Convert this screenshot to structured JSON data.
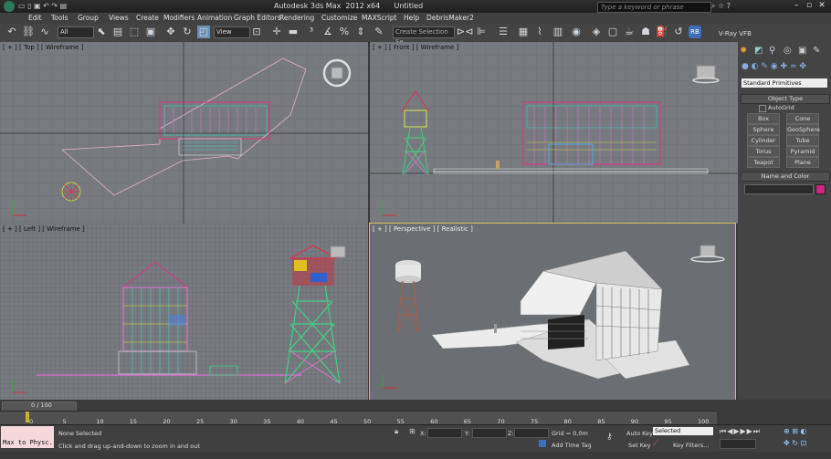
{
  "window": {
    "title": "Autodesk 3ds Max  2012 x64      Untitled",
    "search_placeholder": "Type a keyword or phrase"
  },
  "menu": [
    "Edit",
    "Tools",
    "Group",
    "Views",
    "Create",
    "Modifiers",
    "Animation",
    "Graph Editors",
    "Rendering",
    "Customize",
    "MAXScript",
    "Help",
    "DebrisMaker2"
  ],
  "toolbar": {
    "filter_value": "All",
    "view_value": "View",
    "selection_set_placeholder": "Create Selection Se",
    "vray_label": "V-Ray VFB"
  },
  "viewports": {
    "top_label": "[ + ] [ Top ] [ Wireframe ]",
    "front_label": "[ + ] [ Front ] [ Wireframe ]",
    "left_label": "[ + ] [ Left ] [ Wireframe ]",
    "perspective_label": "[ + ] [ Perspective ] [ Realistic ]"
  },
  "command_panel": {
    "category": "Standard Primitives",
    "object_type_title": "Object Type",
    "autogrid": "AutoGrid",
    "buttons": [
      "Box",
      "Cone",
      "Sphere",
      "GeoSphere",
      "Cylinder",
      "Tube",
      "Torus",
      "Pyramid",
      "Teapot",
      "Plane"
    ],
    "name_color_title": "Name and Color",
    "object_color": "#c8287f"
  },
  "timeline": {
    "frame_range": "0 / 100",
    "ticks": [
      "0",
      "5",
      "10",
      "15",
      "20",
      "25",
      "30",
      "35",
      "40",
      "45",
      "50",
      "55",
      "60",
      "65",
      "70",
      "75",
      "80",
      "85",
      "90",
      "95",
      "100"
    ]
  },
  "status": {
    "script_listener": "Max to Physc.",
    "selection": "None Selected",
    "prompt": "Click and drag up-and-down to zoom in and out",
    "x_label": "X:",
    "y_label": "Y:",
    "z_label": "Z:",
    "grid": "Grid = 0,0m",
    "add_time_tag": "Add Time Tag",
    "auto_key": "Auto Key",
    "set_key": "Set Key",
    "key_mode": "Selected",
    "key_filters": "Key Filters..."
  }
}
